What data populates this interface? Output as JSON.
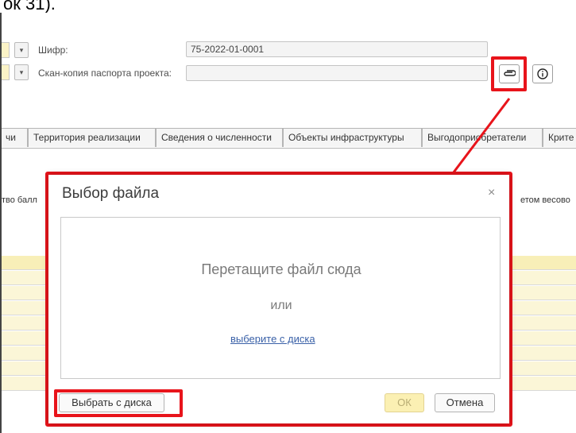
{
  "caption": {
    "text": "ок 31)."
  },
  "header": {
    "code_label": "Шифр:",
    "code_value": "75-2022-01-0001",
    "scan_label": "Скан-копия паспорта проекта:",
    "scan_value": "",
    "dropdown_glyph": "▾"
  },
  "tabs": [
    {
      "label": "чи"
    },
    {
      "label": "Территория реализации"
    },
    {
      "label": "Сведения о численности"
    },
    {
      "label": "Объекты инфраструктуры"
    },
    {
      "label": "Выгодоприобретатели"
    },
    {
      "label": "Крите"
    }
  ],
  "table": {
    "col_left": "тво балл",
    "col_right": "етом весово"
  },
  "dialog": {
    "title": "Выбор файла",
    "close_glyph": "×",
    "drop_text": "Перетащите файл сюда",
    "or_text": "или",
    "link_text": "выберите с диска",
    "choose_button": "Выбрать с диска",
    "ok_button": "ОК",
    "cancel_button": "Отмена"
  },
  "colors": {
    "highlight": "#e8141b",
    "link": "#3a61a8",
    "ok_button_bg": "#fbf0b3",
    "row_bg": "#fbf6d7"
  },
  "icons": [
    "paperclip-icon",
    "info-icon",
    "close-icon",
    "chevron-down-icon"
  ]
}
